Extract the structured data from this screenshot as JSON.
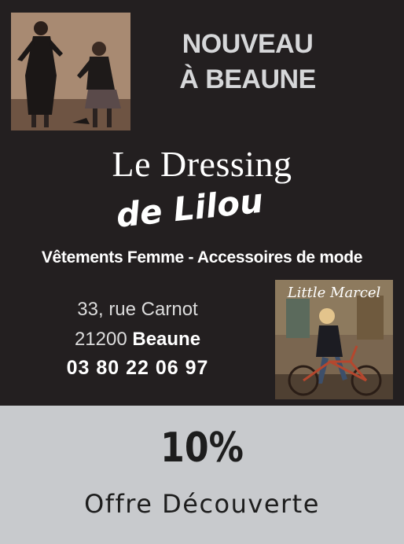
{
  "ad": {
    "headline_line1": "NOUVEAU",
    "headline_line2": "À BEAUNE",
    "brand_line1": "Le Dressing",
    "brand_line2": "de Lilou",
    "tagline": "Vêtements Femme - Accessoires de mode",
    "address": {
      "street": "33, rue Carnot",
      "postal_code": "21200",
      "city": "Beaune",
      "phone": "03 80 22 06 97"
    },
    "photo2_label": "Little Marcel"
  },
  "promo": {
    "discount": "10%",
    "label": "Offre Découverte"
  },
  "colors": {
    "top_background": "#231f20",
    "bottom_background": "#c8cacd",
    "headline_text": "#d6d7d9"
  }
}
